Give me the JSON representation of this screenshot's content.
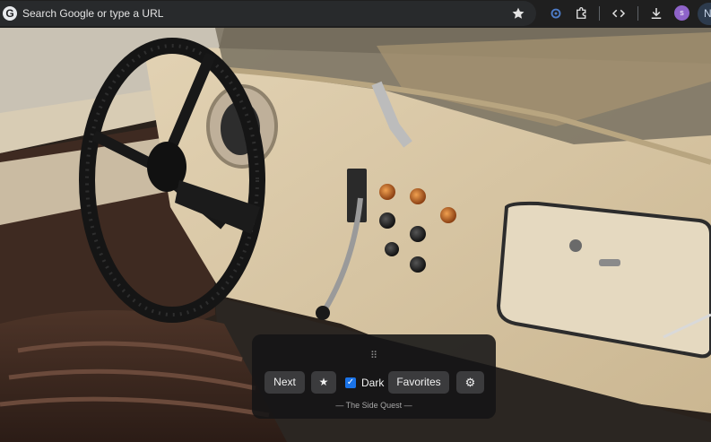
{
  "browser": {
    "omnibox_placeholder": "Search Google or type a URL",
    "avatar_initial": "s",
    "profile_initial": "N"
  },
  "panel": {
    "next_label": "Next",
    "favorite_icon_glyph": "★",
    "dark_label": "Dark",
    "dark_checked": true,
    "favorites_label": "Favorites",
    "settings_icon_glyph": "⚙",
    "credit": "— The Side Quest —"
  },
  "icons": [
    "google-logo-icon",
    "bookmark-star-icon",
    "extension-status-icon",
    "extensions-puzzle-icon",
    "code-icon",
    "download-icon",
    "drag-handle-icon",
    "favorite-star-icon",
    "settings-gear-icon"
  ],
  "colors": {
    "toolbar": "#1f1f1f",
    "omnibox": "#282a2c",
    "accent": "#1a73e8",
    "panel": "#141416"
  }
}
